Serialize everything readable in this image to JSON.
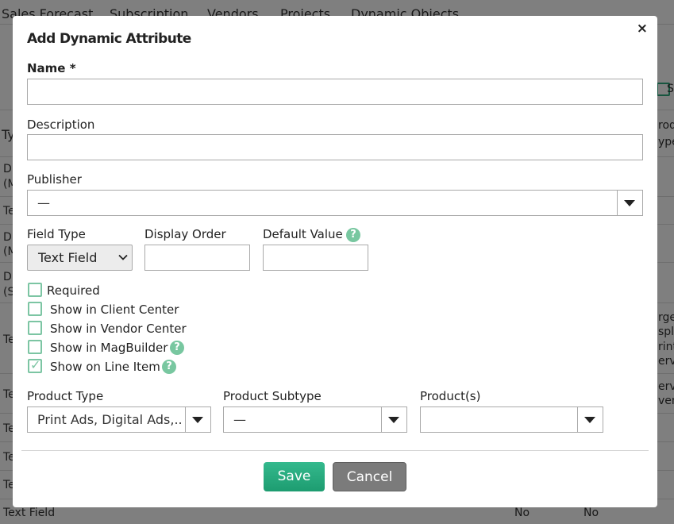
{
  "background": {
    "nav_tabs": [
      "Sales Forecast",
      "Subscription",
      "Vendors",
      "Projects",
      "Dynamic Objects"
    ],
    "left_cells": [
      "Ty",
      "Di",
      "(M",
      "Te",
      "Di",
      "(M",
      "Di",
      "(S",
      "Te",
      "Te",
      "Te",
      "Te",
      "Te"
    ],
    "right_cells": [
      "rod",
      "ype",
      "rge",
      "spl",
      "rint",
      "ervi",
      "ervi",
      "ven"
    ],
    "header_right_fragment": "S",
    "last_row": {
      "type": "Text Field",
      "col1": "No",
      "col2": "No"
    }
  },
  "modal": {
    "title": "Add Dynamic Attribute",
    "close_glyph": "×",
    "name": {
      "label": "Name *",
      "value": ""
    },
    "description": {
      "label": "Description",
      "value": ""
    },
    "publisher": {
      "label": "Publisher",
      "value": "—"
    },
    "field_type": {
      "label": "Field Type",
      "value": "Text Field"
    },
    "display_order": {
      "label": "Display Order",
      "value": ""
    },
    "default_value": {
      "label": "Default Value",
      "value": ""
    },
    "help_glyph": "?",
    "checkboxes": [
      {
        "label": "Required",
        "checked": false,
        "help": false
      },
      {
        "label": "Show in Client Center",
        "checked": false,
        "help": false
      },
      {
        "label": "Show in Vendor Center",
        "checked": false,
        "help": false
      },
      {
        "label": "Show in MagBuilder",
        "checked": false,
        "help": true
      },
      {
        "label": "Show on Line Item",
        "checked": true,
        "help": true
      }
    ],
    "product_type": {
      "label": "Product Type",
      "value": "Print Ads, Digital Ads,..."
    },
    "product_subtype": {
      "label": "Product Subtype",
      "value": "—"
    },
    "products": {
      "label": "Product(s)",
      "value": ""
    },
    "buttons": {
      "save": "Save",
      "cancel": "Cancel"
    },
    "colors": {
      "accent": "#1d9c70",
      "help": "#78c7a0",
      "checkbox": "#7cc5a3",
      "cancel": "#7b7b7b"
    },
    "icons": {
      "caret": "caret-down-icon",
      "check": "check-icon",
      "close": "close-icon",
      "help": "help-icon"
    }
  }
}
